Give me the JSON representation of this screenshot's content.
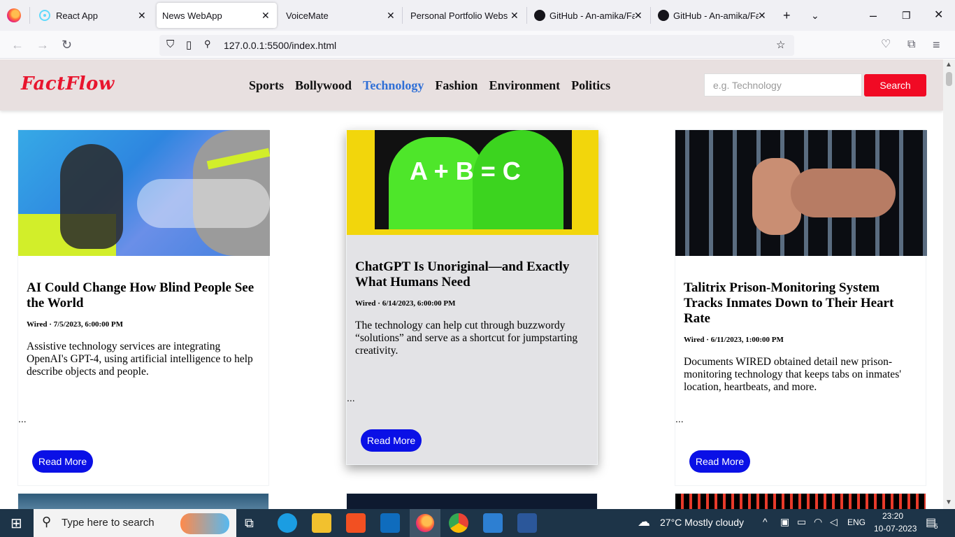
{
  "browser": {
    "tabs": [
      {
        "label": "React App",
        "icon": "react-icon"
      },
      {
        "label": "News WebApp",
        "active": true
      },
      {
        "label": "VoiceMate"
      },
      {
        "label": "Personal Portfolio Website"
      },
      {
        "label": "GitHub - An-amika/Fa",
        "icon": "github-icon"
      },
      {
        "label": "GitHub - An-amika/Fa",
        "icon": "github-icon"
      }
    ],
    "url": "127.0.0.1:5500/index.html"
  },
  "site": {
    "brand": "FactFlow",
    "nav": [
      "Sports",
      "Bollywood",
      "Technology",
      "Fashion",
      "Environment",
      "Politics"
    ],
    "active_nav": "Technology",
    "search_placeholder": "e.g. Technology",
    "search_button": "Search"
  },
  "cards": [
    {
      "title": "AI Could Change How Blind People See the World",
      "meta": "Wired · 7/5/2023, 6:00:00 PM",
      "description": "Assistive technology services are integrating OpenAI's GPT-4, using artificial intelligence to help describe objects and people.",
      "ellipsis": "...",
      "read_more": "Read More"
    },
    {
      "title": "ChatGPT Is Unoriginal—and Exactly What Humans Need",
      "meta": "Wired · 6/14/2023, 6:00:00 PM",
      "description": "The technology can help cut through buzzwordy “solutions” and serve as a shortcut for jumpstarting creativity.",
      "ellipsis": "...",
      "read_more": "Read More",
      "image_text": "A + B = C"
    },
    {
      "title": "Talitrix Prison-Monitoring System Tracks Inmates Down to Their Heart Rate",
      "meta": "Wired · 6/11/2023, 1:00:00 PM",
      "description": "Documents WIRED obtained detail new prison-monitoring technology that keeps tabs on inmates' location, heartbeats, and more.",
      "ellipsis": "...",
      "read_more": "Read More"
    }
  ],
  "taskbar": {
    "search_placeholder": "Type here to search",
    "weather": "27°C  Mostly cloudy",
    "lang": "ENG",
    "time": "23:20",
    "date": "10-07-2023",
    "notifications": "5"
  },
  "colors": {
    "brand": "#e8152e",
    "accent": "#2f6fd6",
    "search_button": "#f10a24",
    "read_more": "#0a10e6"
  }
}
